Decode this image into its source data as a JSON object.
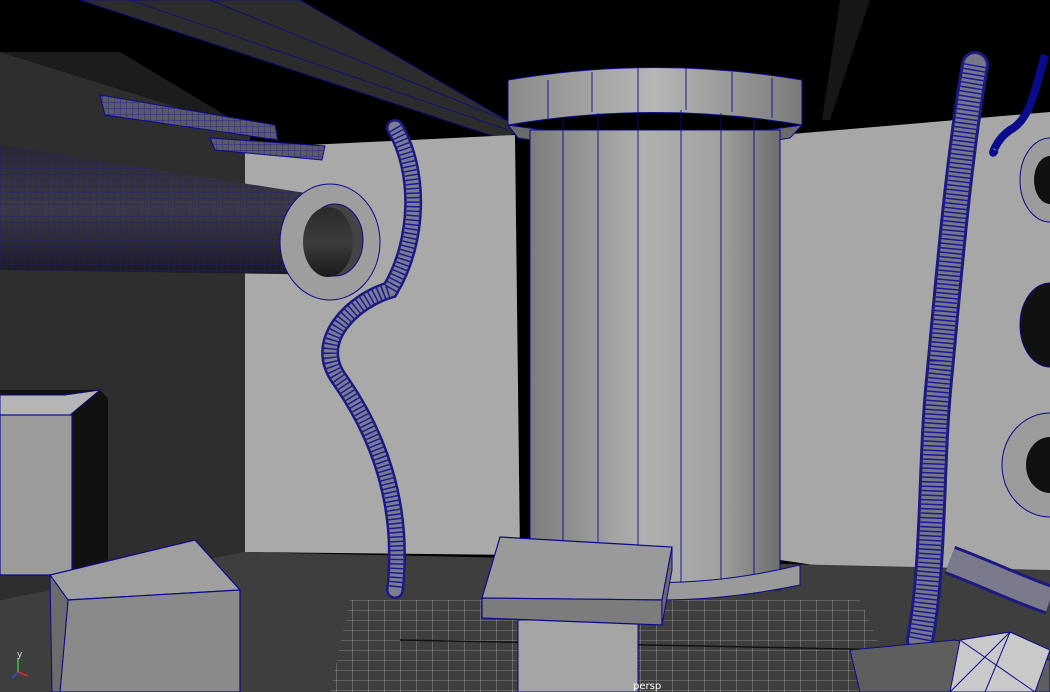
{
  "viewport": {
    "camera_label": "persp",
    "background_color": "#000000",
    "wireframe_color": "#0a0a8c",
    "surface_color": "#8f8f8f"
  },
  "axis_gizmo": {
    "y_label": "y",
    "x_color": "#d03030",
    "y_color": "#30d030",
    "z_color": "#3050e0"
  }
}
